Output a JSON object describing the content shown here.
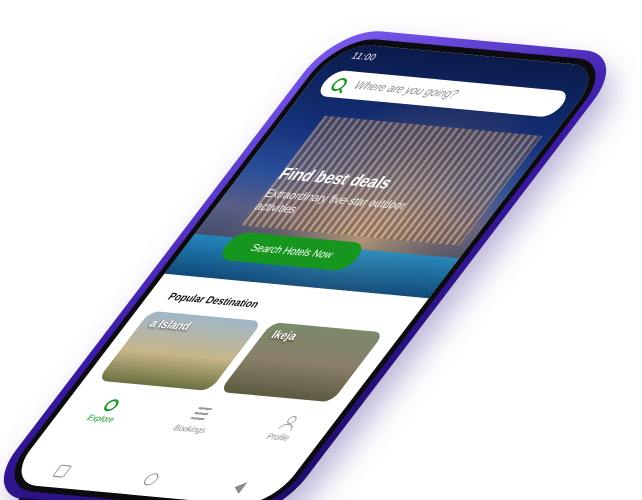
{
  "status_bar": {
    "time": "11:00"
  },
  "search": {
    "placeholder": "Where are you going?"
  },
  "hero": {
    "title": "Find best deals",
    "subtitle": "Extraordinary five-star outdoor activities",
    "cta_label": "Search Hotels Now"
  },
  "popular": {
    "title": "Popular Destination",
    "cards": [
      {
        "label": "a Island"
      },
      {
        "label": "Ikeja"
      }
    ]
  },
  "tabs": [
    {
      "label": "Explore",
      "icon": "search-icon"
    },
    {
      "label": "Bookings",
      "icon": "list-icon"
    },
    {
      "label": "Profile",
      "icon": "user-icon"
    }
  ],
  "colors": {
    "brand_green": "#17961f",
    "phone_purple": "#3a1aa3"
  }
}
